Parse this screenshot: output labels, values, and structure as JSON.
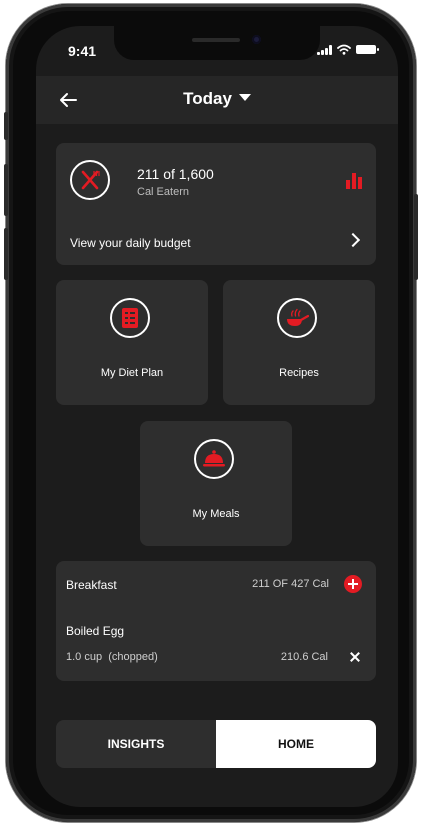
{
  "status_bar": {
    "time": "9:41"
  },
  "header": {
    "title": "Today",
    "back_icon": "arrow-left-icon",
    "dropdown_icon": "caret-down-icon"
  },
  "budget": {
    "calories_text": "211 of 1,600",
    "subtitle": "Cal Eatern",
    "link_text": "View your daily budget",
    "icon": "fork-knife-icon",
    "chart_icon": "bar-chart-icon"
  },
  "tiles": [
    {
      "label": "My Diet Plan",
      "icon": "diet-plan-icon"
    },
    {
      "label": "Recipes",
      "icon": "frying-pan-icon"
    },
    {
      "label": "My Meals",
      "icon": "cloche-icon"
    }
  ],
  "meal": {
    "title": "Breakfast",
    "calories": "211 OF 427 Cal",
    "item_name": "Boiled Egg",
    "item_quantity": "1.0 cup  (chopped)",
    "item_calories": "210.6 Cal"
  },
  "tabs": {
    "insights": "INSIGHTS",
    "home": "HOME",
    "active": "home"
  },
  "colors": {
    "accent": "#e31b23",
    "background": "#1c1c1c",
    "card": "#2e2e2e",
    "header": "#262626"
  }
}
